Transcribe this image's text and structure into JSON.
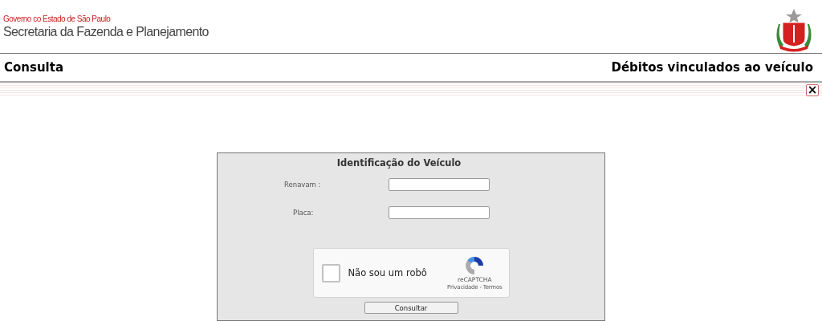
{
  "header": {
    "government": "Governo co Estado de São Paulo",
    "secretariat": "Secretaria da Fazenda e Planejamento"
  },
  "section_bar": {
    "left_title": "Consulta",
    "right_title": "Débitos vinculados ao veículo"
  },
  "close_button": {
    "label": "×"
  },
  "form": {
    "title": "Identificação do Veículo",
    "fields": [
      {
        "label": "Renavam :"
      },
      {
        "label": "Placa:"
      }
    ],
    "captcha": {
      "label": "Não sou um robô",
      "checked": false,
      "brand": "reCAPTCHA",
      "privacy": "Privacidade",
      "separator": "-",
      "terms": "Termos"
    },
    "submit": "Consultar"
  }
}
